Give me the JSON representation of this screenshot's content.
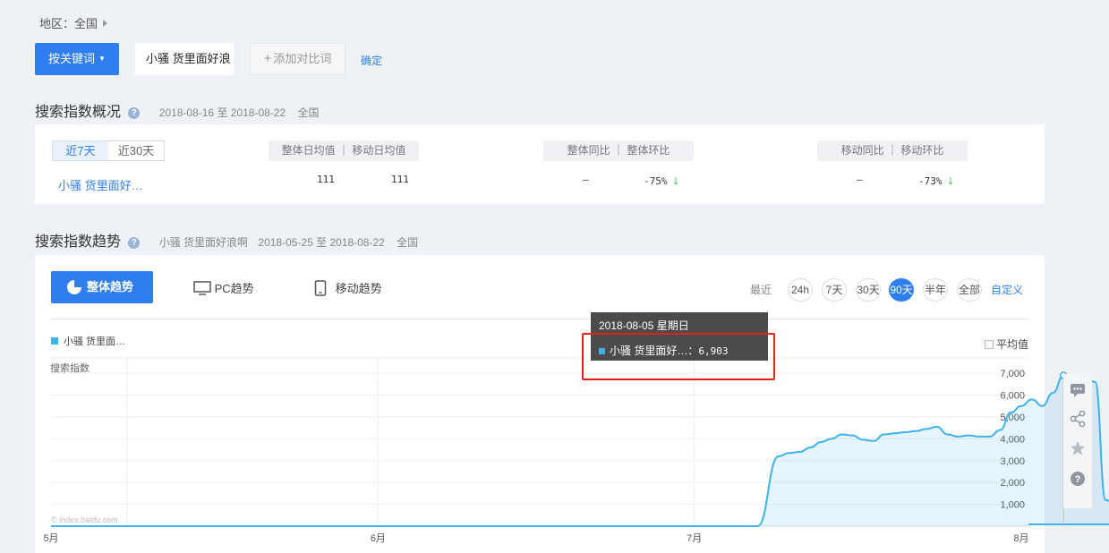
{
  "region": {
    "label": "地区：全国"
  },
  "keyword_bar": {
    "keyword_button": "按关键词",
    "keyword_value": "小骚 货里面好浪",
    "add_compare": "添加对比词",
    "confirm": "确定"
  },
  "overview": {
    "title": "搜索指数概况",
    "date_range": "2018-08-16 至 2018-08-22",
    "region": "全国",
    "tabs": [
      "近7天",
      "近30天"
    ],
    "col_headers": [
      "整体日均值 ｜ 移动日均值",
      "整体同比 ｜ 整体环比",
      "移动同比 ｜ 移动环比"
    ],
    "row": {
      "keyword": "小骚 货里面好…",
      "overall_avg": "111",
      "mobile_avg": "111",
      "overall_yoy": "–",
      "overall_mom": "-75%",
      "mobile_yoy": "–",
      "mobile_mom": "-73%"
    }
  },
  "trend": {
    "title": "搜索指数趋势",
    "keyword": "小骚 货里面好浪啊",
    "date_range": "2018-05-25 至 2018-08-22",
    "region": "全国",
    "tabs": {
      "overall": "整体趋势",
      "pc": "PC趋势",
      "mobile": "移动趋势"
    },
    "range_label": "最近",
    "ranges": [
      "24h",
      "7天",
      "30天",
      "90天",
      "半年",
      "全部"
    ],
    "active_range": "90天",
    "custom": "自定义",
    "legend": "小骚 货里面…",
    "avg_label": "平均值",
    "ylabel": "搜索指数",
    "watermark": "© index.baidu.com",
    "tooltip": {
      "date": "2018-08-05 星期日",
      "series": "小骚 货里面好…：",
      "value": "6,903"
    }
  },
  "chart_data": {
    "type": "area",
    "ylabel": "搜索指数",
    "x_ticks": [
      "5月",
      "6月",
      "7月",
      "8月"
    ],
    "y_ticks": [
      "1,000",
      "2,000",
      "3,000",
      "4,000",
      "5,000",
      "6,000",
      "7,000"
    ],
    "ylim": [
      0,
      7700
    ],
    "grid": true,
    "series": [
      {
        "name": "小骚 货里面好浪啊",
        "color": "#3cb2ef",
        "points": [
          [
            "2018-05-25",
            0
          ],
          [
            "2018-05-31",
            0
          ],
          [
            "2018-06-10",
            0
          ],
          [
            "2018-06-20",
            0
          ],
          [
            "2018-06-30",
            0
          ],
          [
            "2018-07-07",
            0
          ],
          [
            "2018-07-09",
            3200
          ],
          [
            "2018-07-10",
            3350
          ],
          [
            "2018-07-11",
            3400
          ],
          [
            "2018-07-12",
            3600
          ],
          [
            "2018-07-13",
            3850
          ],
          [
            "2018-07-14",
            4000
          ],
          [
            "2018-07-15",
            4200
          ],
          [
            "2018-07-16",
            4150
          ],
          [
            "2018-07-17",
            3950
          ],
          [
            "2018-07-18",
            3900
          ],
          [
            "2018-07-19",
            4200
          ],
          [
            "2018-07-20",
            4250
          ],
          [
            "2018-07-21",
            4300
          ],
          [
            "2018-07-22",
            4350
          ],
          [
            "2018-07-23",
            4450
          ],
          [
            "2018-07-24",
            4550
          ],
          [
            "2018-07-25",
            4200
          ],
          [
            "2018-07-26",
            4100
          ],
          [
            "2018-07-27",
            4150
          ],
          [
            "2018-07-28",
            4100
          ],
          [
            "2018-07-29",
            4100
          ],
          [
            "2018-07-30",
            4400
          ],
          [
            "2018-07-31",
            5200
          ],
          [
            "2018-08-01",
            5500
          ],
          [
            "2018-08-02",
            5800
          ],
          [
            "2018-08-03",
            5500
          ],
          [
            "2018-08-04",
            6100
          ],
          [
            "2018-08-05",
            6903
          ],
          [
            "2018-08-06",
            6750
          ],
          [
            "2018-08-07",
            6850
          ],
          [
            "2018-08-08",
            6600
          ],
          [
            "2018-08-09",
            1200
          ],
          [
            "2018-08-10",
            900
          ],
          [
            "2018-08-11",
            300
          ],
          [
            "2018-08-12",
            200
          ],
          [
            "2018-08-13",
            200
          ],
          [
            "2018-08-15",
            100
          ],
          [
            "2018-08-18",
            80
          ],
          [
            "2018-08-22",
            80
          ]
        ]
      }
    ]
  }
}
